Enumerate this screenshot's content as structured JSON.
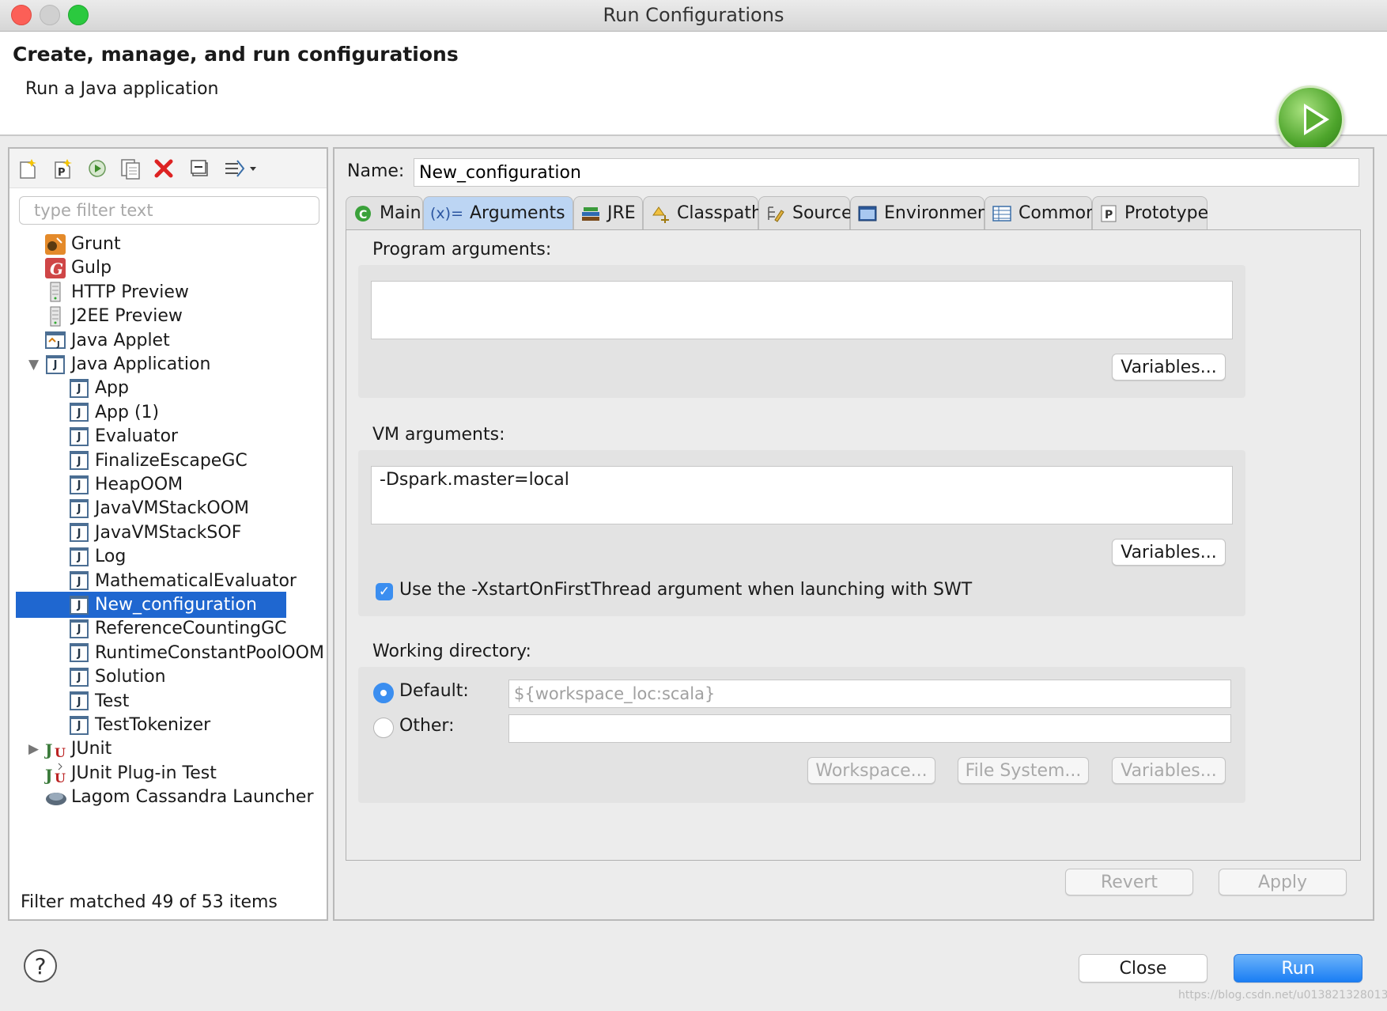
{
  "window": {
    "title": "Run Configurations"
  },
  "header": {
    "title": "Create, manage, and run configurations",
    "subtitle": "Run a Java application"
  },
  "toolbar": {
    "icons": [
      "new-configuration-icon",
      "new-prototype-icon",
      "export-icon",
      "duplicate-icon",
      "delete-icon",
      "collapse-all-icon",
      "filter-icon"
    ]
  },
  "filter": {
    "placeholder": "type filter text",
    "value": ""
  },
  "tree": {
    "items": [
      {
        "label": "Grunt",
        "icon": "grunt-icon",
        "level": 0
      },
      {
        "label": "Gulp",
        "icon": "gulp-icon",
        "level": 0
      },
      {
        "label": "HTTP Preview",
        "icon": "server-icon",
        "level": 0
      },
      {
        "label": "J2EE Preview",
        "icon": "server-icon",
        "level": 0
      },
      {
        "label": "Java Applet",
        "icon": "applet-icon",
        "level": 0
      },
      {
        "label": "Java Application",
        "icon": "java-app-icon",
        "level": 0,
        "expanded": true
      },
      {
        "label": "App",
        "icon": "java-app-icon",
        "level": 1
      },
      {
        "label": "App (1)",
        "icon": "java-app-icon",
        "level": 1
      },
      {
        "label": "Evaluator",
        "icon": "java-app-icon",
        "level": 1
      },
      {
        "label": "FinalizeEscapeGC",
        "icon": "java-app-icon",
        "level": 1
      },
      {
        "label": "HeapOOM",
        "icon": "java-app-icon",
        "level": 1
      },
      {
        "label": "JavaVMStackOOM",
        "icon": "java-app-icon",
        "level": 1
      },
      {
        "label": "JavaVMStackSOF",
        "icon": "java-app-icon",
        "level": 1
      },
      {
        "label": "Log",
        "icon": "java-app-icon",
        "level": 1
      },
      {
        "label": "MathematicalEvaluator",
        "icon": "java-app-icon",
        "level": 1
      },
      {
        "label": "New_configuration",
        "icon": "java-app-icon",
        "level": 1,
        "selected": true
      },
      {
        "label": "ReferenceCountingGC",
        "icon": "java-app-icon",
        "level": 1
      },
      {
        "label": "RuntimeConstantPoolOOM",
        "icon": "java-app-icon",
        "level": 1
      },
      {
        "label": "Solution",
        "icon": "java-app-icon",
        "level": 1
      },
      {
        "label": "Test",
        "icon": "java-app-icon",
        "level": 1
      },
      {
        "label": "TestTokenizer",
        "icon": "java-app-icon",
        "level": 1
      },
      {
        "label": "JUnit",
        "icon": "junit-icon",
        "level": 0,
        "expanded": false
      },
      {
        "label": "JUnit Plug-in Test",
        "icon": "junit-plugin-icon",
        "level": 0
      },
      {
        "label": "Lagom Cassandra Launcher",
        "icon": "lagom-icon",
        "level": 0
      }
    ],
    "status": "Filter matched 49 of 53 items"
  },
  "config": {
    "name_label": "Name:",
    "name_value": "New_configuration",
    "tabs": [
      {
        "label": "Main",
        "icon": "main-tab-icon"
      },
      {
        "label": "Arguments",
        "prefix": "(x)=",
        "icon": "arguments-tab-icon",
        "active": true
      },
      {
        "label": "JRE",
        "icon": "jre-tab-icon"
      },
      {
        "label": "Classpath",
        "icon": "classpath-tab-icon"
      },
      {
        "label": "Source",
        "icon": "source-tab-icon"
      },
      {
        "label": "Environment",
        "icon": "environment-tab-icon"
      },
      {
        "label": "Common",
        "icon": "common-tab-icon"
      },
      {
        "label": "Prototype",
        "icon": "prototype-tab-icon"
      }
    ],
    "program_args": {
      "label": "Program arguments:",
      "value": "",
      "variables_button": "Variables..."
    },
    "vm_args": {
      "label": "VM arguments:",
      "value": "-Dspark.master=local",
      "variables_button": "Variables..."
    },
    "swt_checkbox": {
      "label": "Use the -XstartOnFirstThread argument when launching with SWT",
      "checked": true
    },
    "working_dir": {
      "label": "Working directory:",
      "default_label": "Default:",
      "default_value": "${workspace_loc:scala}",
      "other_label": "Other:",
      "other_value": "",
      "workspace_button": "Workspace...",
      "filesystem_button": "File System...",
      "variables_button": "Variables..."
    },
    "revert_button": "Revert",
    "apply_button": "Apply"
  },
  "footer": {
    "close_button": "Close",
    "run_button": "Run",
    "help_icon": "?"
  },
  "watermark": "https://blog.csdn.net/u013821328013",
  "colors": {
    "selection": "#1f67d0",
    "accent": "#3b8ef0",
    "run_button": "#1a7ef4"
  }
}
